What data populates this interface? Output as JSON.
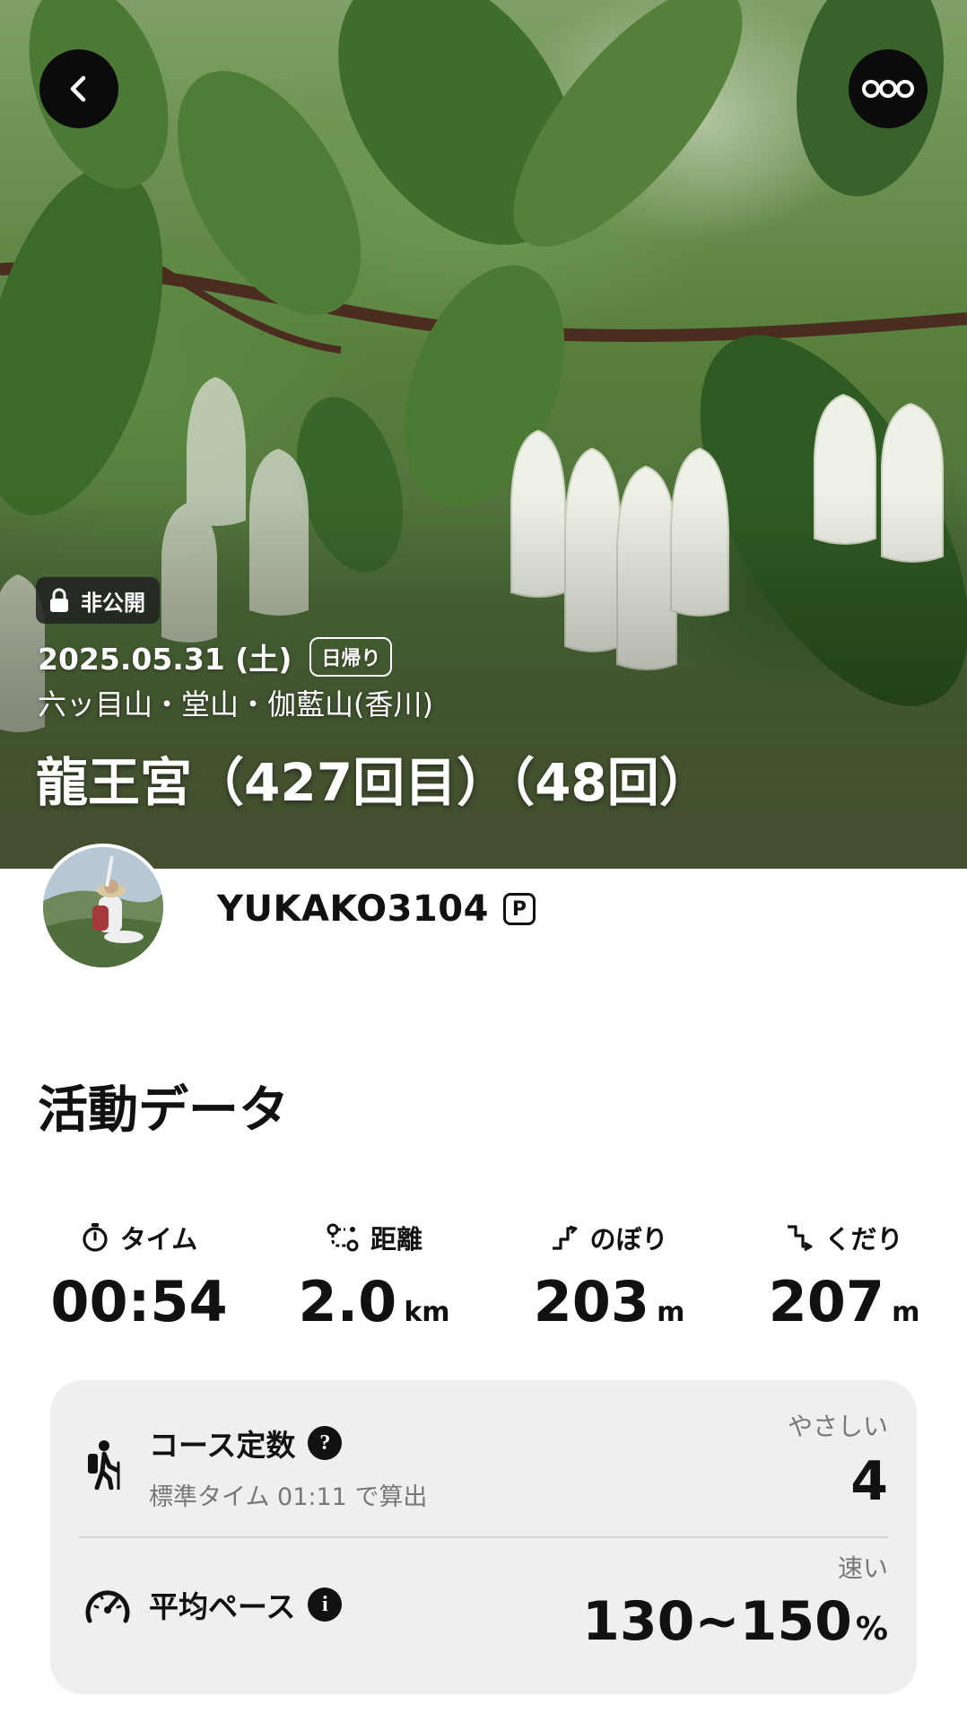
{
  "hero": {
    "privacy_label": "非公開",
    "date": "2025.05.31 (土)",
    "trip_type": "日帰り",
    "mountains": "六ッ目山・堂山・伽藍山(香川)",
    "title": "龍王宮（427回目）（48回）"
  },
  "user": {
    "name": "YUKAKO3104",
    "badge": "P"
  },
  "activity": {
    "section_title": "活動データ",
    "stats": [
      {
        "label": "タイム",
        "value": "00:54",
        "unit": "",
        "icon": "stopwatch-icon"
      },
      {
        "label": "距離",
        "value": "2.0",
        "unit": "km",
        "icon": "route-icon"
      },
      {
        "label": "のぼり",
        "value": "203",
        "unit": "m",
        "icon": "ascent-icon"
      },
      {
        "label": "くだり",
        "value": "207",
        "unit": "m",
        "icon": "descent-icon"
      }
    ],
    "course": {
      "title": "コース定数",
      "subtitle": "標準タイム 01:11 で算出",
      "rating_label": "やさしい",
      "rating_value": "4"
    },
    "pace": {
      "title": "平均ペース",
      "rating_label": "速い",
      "rating_value": "130~150",
      "unit": "%"
    }
  },
  "colors": {
    "text": "#111111",
    "muted": "#777777",
    "card_bg": "#efefef"
  }
}
